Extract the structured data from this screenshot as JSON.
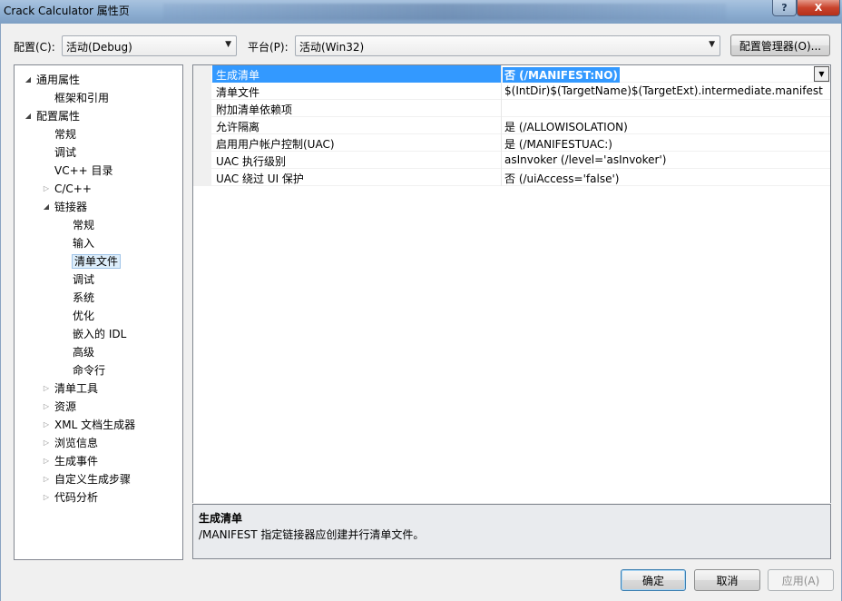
{
  "window": {
    "title": "Crack Calculator 属性页",
    "help_label": "?",
    "close_label": "X"
  },
  "toolbar": {
    "config_label": "配置(C):",
    "config_value": "活动(Debug)",
    "platform_label": "平台(P):",
    "platform_value": "活动(Win32)",
    "config_manager_label": "配置管理器(O)..."
  },
  "tree": {
    "items": [
      {
        "label": "通用属性",
        "expander": "expanded"
      },
      {
        "label": "框架和引用",
        "expander": "none"
      },
      {
        "label": "配置属性",
        "expander": "expanded"
      },
      {
        "label": "常规",
        "expander": "none"
      },
      {
        "label": "调试",
        "expander": "none"
      },
      {
        "label": "VC++ 目录",
        "expander": "none"
      },
      {
        "label": "C/C++",
        "expander": "collapsed"
      },
      {
        "label": "链接器",
        "expander": "expanded"
      },
      {
        "label": "常规",
        "expander": "none"
      },
      {
        "label": "输入",
        "expander": "none"
      },
      {
        "label": "清单文件",
        "expander": "none",
        "selected": true
      },
      {
        "label": "调试",
        "expander": "none"
      },
      {
        "label": "系统",
        "expander": "none"
      },
      {
        "label": "优化",
        "expander": "none"
      },
      {
        "label": "嵌入的 IDL",
        "expander": "none"
      },
      {
        "label": "高级",
        "expander": "none"
      },
      {
        "label": "命令行",
        "expander": "none"
      },
      {
        "label": "清单工具",
        "expander": "collapsed"
      },
      {
        "label": "资源",
        "expander": "collapsed"
      },
      {
        "label": "XML 文档生成器",
        "expander": "collapsed"
      },
      {
        "label": "浏览信息",
        "expander": "collapsed"
      },
      {
        "label": "生成事件",
        "expander": "collapsed"
      },
      {
        "label": "自定义生成步骤",
        "expander": "collapsed"
      },
      {
        "label": "代码分析",
        "expander": "collapsed"
      }
    ]
  },
  "properties": {
    "rows": [
      {
        "name": "生成清单",
        "value": "否 (/MANIFEST:NO)",
        "selected": true
      },
      {
        "name": "清单文件",
        "value": "$(IntDir)$(TargetName)$(TargetExt).intermediate.manifest"
      },
      {
        "name": "附加清单依赖项",
        "value": ""
      },
      {
        "name": "允许隔离",
        "value": "是 (/ALLOWISOLATION)"
      },
      {
        "name": "启用用户帐户控制(UAC)",
        "value": "是 (/MANIFESTUAC:)"
      },
      {
        "name": "UAC 执行级别",
        "value": "asInvoker (/level='asInvoker')"
      },
      {
        "name": "UAC 绕过 UI 保护",
        "value": "否 (/uiAccess='false')"
      }
    ]
  },
  "description": {
    "title": "生成清单",
    "text": "/MANIFEST 指定链接器应创建并行清单文件。"
  },
  "buttons": {
    "ok": "确定",
    "cancel": "取消",
    "apply": "应用(A)"
  },
  "colors": {
    "selection": "#3399ff",
    "titlebar": "#8fb0d3",
    "dialog_bg": "#f0f0f0"
  }
}
